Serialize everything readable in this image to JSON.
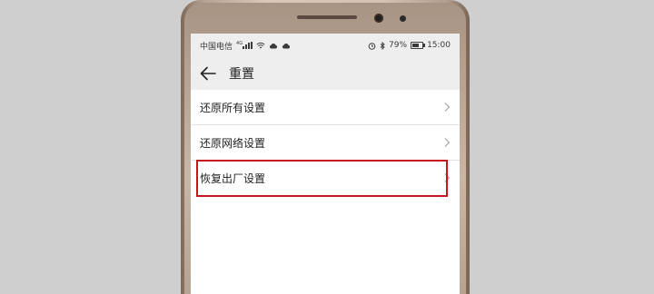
{
  "status_bar": {
    "carrier": "中国电信",
    "network_badge": "4G",
    "battery_percent": "79%",
    "time": "15:00",
    "icons": [
      "wifi-icon",
      "cloud-icon",
      "alarm-icon",
      "bluetooth-icon",
      "battery-icon"
    ]
  },
  "header": {
    "title": "重置"
  },
  "settings": {
    "items": [
      {
        "label": "还原所有设置"
      },
      {
        "label": "还原网络设置"
      },
      {
        "label": "恢复出厂设置"
      }
    ]
  },
  "colors": {
    "highlight": "#c8141e",
    "background": "#cfcfcf",
    "bar": "#eeeeee"
  }
}
